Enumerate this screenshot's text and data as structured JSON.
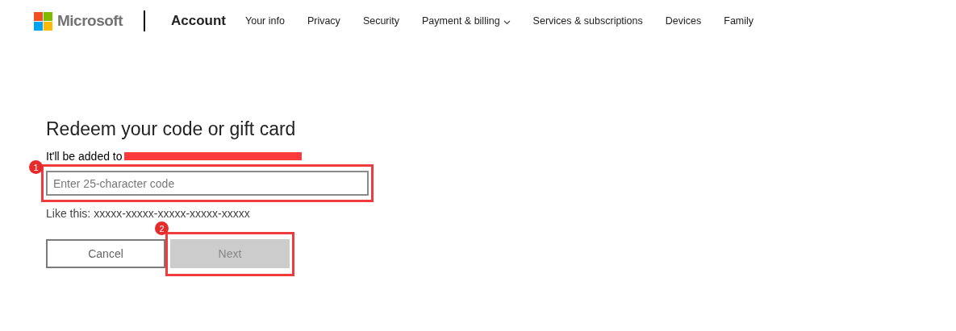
{
  "header": {
    "brand": "Microsoft",
    "section": "Account",
    "nav": [
      {
        "label": "Your info",
        "dropdown": false
      },
      {
        "label": "Privacy",
        "dropdown": false
      },
      {
        "label": "Security",
        "dropdown": false
      },
      {
        "label": "Payment & billing",
        "dropdown": true
      },
      {
        "label": "Services & subscriptions",
        "dropdown": false
      },
      {
        "label": "Devices",
        "dropdown": false
      },
      {
        "label": "Family",
        "dropdown": false
      }
    ]
  },
  "form": {
    "title": "Redeem your code or gift card",
    "subtitle": "It'll be added to",
    "code_field": {
      "placeholder": "Enter 25-character code",
      "annotation": "1"
    },
    "hint": "Like this: xxxxx-xxxxx-xxxxx-xxxxx-xxxxx",
    "buttons": [
      {
        "label": "Cancel",
        "disabled": false
      },
      {
        "label": "Next",
        "disabled": true,
        "annotation": "2"
      }
    ]
  }
}
